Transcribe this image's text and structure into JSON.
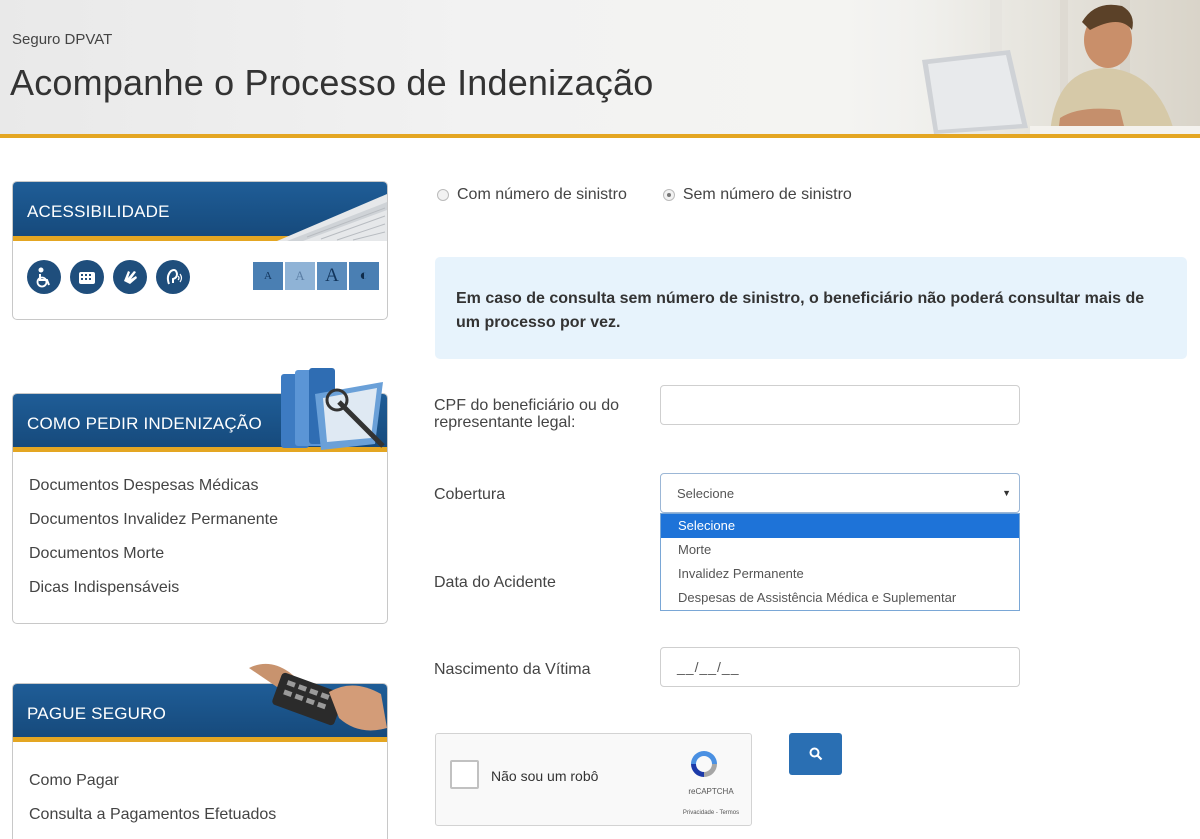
{
  "header": {
    "subtitle": "Seguro DPVAT",
    "title": "Acompanhe o Processo de Indenização"
  },
  "sidebar": {
    "accessibility": {
      "title": "ACESSIBILIDADE",
      "icons": [
        "wheelchair-icon",
        "keyboard-icon",
        "sign-language-icon",
        "audio-icon"
      ],
      "font_buttons": [
        "A",
        "A",
        "A",
        "◐"
      ]
    },
    "como_pedir": {
      "title": "COMO PEDIR INDENIZAÇÃO",
      "links": [
        "Documentos Despesas Médicas",
        "Documentos Invalidez Permanente",
        "Documentos Morte",
        "Dicas Indispensáveis"
      ]
    },
    "pague": {
      "title": "PAGUE SEGURO",
      "links": [
        "Como Pagar",
        "Consulta a Pagamentos Efetuados"
      ]
    }
  },
  "form": {
    "radio_options": [
      {
        "label": "Com número de sinistro",
        "selected": false
      },
      {
        "label": "Sem número de sinistro",
        "selected": true
      }
    ],
    "info_text": "Em caso de consulta sem número de sinistro, o beneficiário não poderá consultar mais de um processo por vez.",
    "cpf_label": "CPF do beneficiário ou do representante legal:",
    "cpf_value": "",
    "cobertura_label": "Cobertura",
    "cobertura_selected": "Selecione",
    "cobertura_options": [
      "Selecione",
      "Morte",
      "Invalidez Permanente",
      "Despesas de Assistência Médica e Suplementar"
    ],
    "data_acidente_label": "Data do Acidente",
    "nascimento_label": "Nascimento da Vítima",
    "nascimento_value": "__/__/__",
    "captcha_label": "Não sou um robô",
    "captcha_brand": "reCAPTCHA",
    "captcha_terms": "Privacidade - Termos",
    "search_icon": "search-icon"
  },
  "colors": {
    "brand_blue": "#1f5d97",
    "accent_gold": "#e4a622",
    "info_bg": "#e7f3fc",
    "select_highlight": "#1e73d8"
  }
}
